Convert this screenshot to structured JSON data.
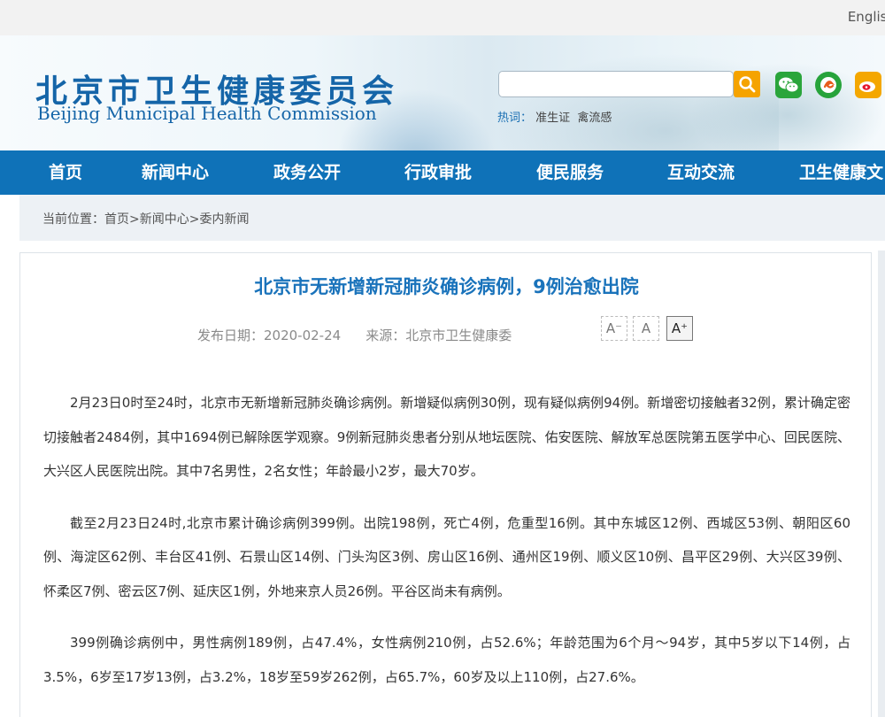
{
  "topbar": {
    "lang_link": "English"
  },
  "header": {
    "title_cn": "北京市卫生健康委员会",
    "title_en": "Beijing Municipal Health Commission",
    "search": {
      "value": "",
      "placeholder": ""
    },
    "hotwords_label": "热词：",
    "hotwords": [
      "准生证",
      "禽流感"
    ],
    "social_icons": [
      "search-icon",
      "wechat-icon",
      "circle-logo-icon",
      "weibo-icon"
    ],
    "accent": "#0f72b8"
  },
  "nav": {
    "items": [
      "首页",
      "新闻中心",
      "政务公开",
      "行政审批",
      "便民服务",
      "互动交流",
      "卫生健康文"
    ]
  },
  "breadcrumb": {
    "label": "当前位置：",
    "items": [
      "首页",
      "新闻中心",
      "委内新闻"
    ]
  },
  "article": {
    "title": "北京市无新增新冠肺炎确诊病例，9例治愈出院",
    "date": "发布日期：2020-02-24",
    "source": "来源：北京市卫生健康委",
    "font_buttons": [
      "A⁻",
      "A",
      "A⁺"
    ],
    "paragraphs": [
      "2月23日0时至24时，北京市无新增新冠肺炎确诊病例。新增疑似病例30例，现有疑似病例94例。新增密切接触者32例，累计确定密切接触者2484例，其中1694例已解除医学观察。9例新冠肺炎患者分别从地坛医院、佑安医院、解放军总医院第五医学中心、回民医院、大兴区人民医院出院。其中7名男性，2名女性；年龄最小2岁，最大70岁。",
      "截至2月23日24时,北京市累计确诊病例399例。出院198例，死亡4例，危重型16例。其中东城区12例、西城区53例、朝阳区60例、海淀区62例、丰台区41例、石景山区14例、门头沟区3例、房山区16例、通州区19例、顺义区10例、昌平区29例、大兴区39例、怀柔区7例、密云区7例、延庆区1例，外地来京人员26例。平谷区尚未有病例。",
      "399例确诊病例中，男性病例189例，占47.4%，女性病例210例，占52.6%；年龄范围为6个月～94岁，其中5岁以下14例，占3.5%，6岁至17岁13例，占3.2%，18岁至59岁262例，占65.7%，60岁及以上110例，占27.6%。"
    ]
  }
}
